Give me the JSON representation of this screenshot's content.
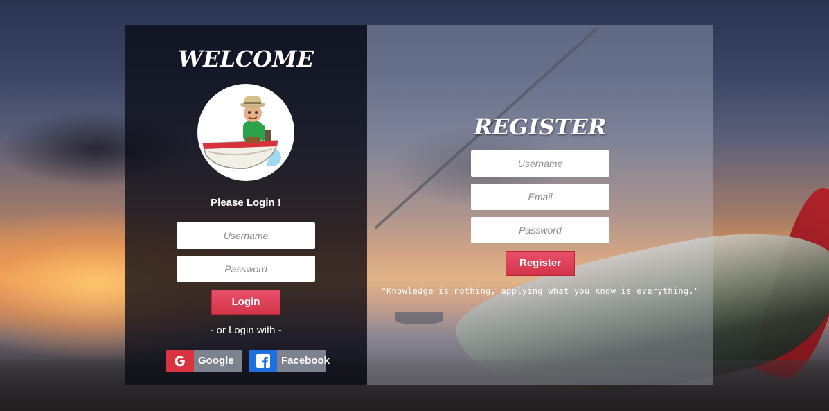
{
  "login": {
    "title": "WELCOME",
    "prompt": "Please Login !",
    "username_placeholder": "Username",
    "password_placeholder": "Password",
    "button_label": "Login",
    "alt_login_text": "- or Login with -",
    "google_label": "Google",
    "facebook_label": "Facebook"
  },
  "register": {
    "title": "REGISTER",
    "username_placeholder": "Username",
    "email_placeholder": "Email",
    "password_placeholder": "Password",
    "button_label": "Register",
    "quote": "\"Knowledge is nothing, applying what you know is everything.\""
  },
  "colors": {
    "accent_red": "#d33548",
    "google": "#d9333f",
    "facebook": "#1e6fe0"
  },
  "icons": {
    "google": "google-g-icon",
    "facebook": "facebook-f-icon",
    "avatar": "fisherman-in-boat-illustration"
  }
}
